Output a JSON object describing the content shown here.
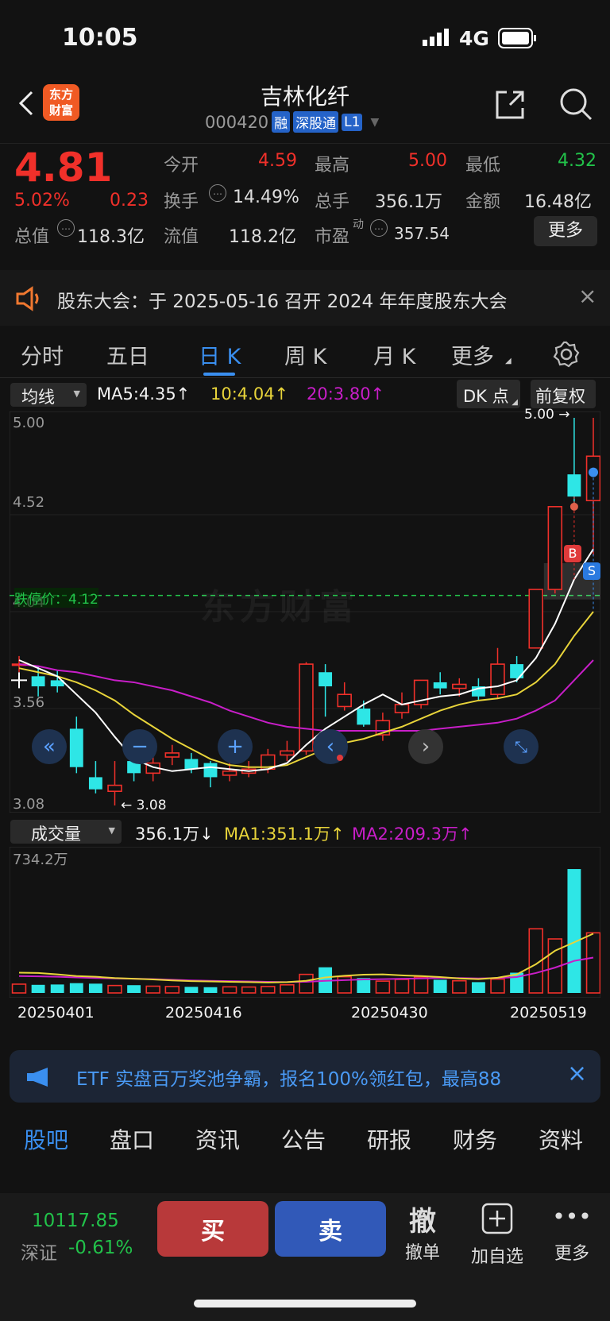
{
  "status_bar": {
    "time": "10:05",
    "network": "4G"
  },
  "header": {
    "title": "吉林化纤",
    "code": "000420",
    "badges": [
      "融",
      "深股通",
      "L1"
    ],
    "logo_text": [
      "东方",
      "财富"
    ]
  },
  "quote": {
    "price": "4.81",
    "change_pct": "5.02%",
    "change": "0.23",
    "open_label": "今开",
    "open": "4.59",
    "high_label": "最高",
    "high": "5.00",
    "low_label": "最低",
    "low": "4.32",
    "turnover_label": "换手",
    "turnover": "14.49%",
    "volume_label": "总手",
    "volume": "356.1万",
    "amount_label": "金额",
    "amount": "16.48亿",
    "mktcap_label": "总值",
    "mktcap": "118.3亿",
    "float_label": "流值",
    "float": "118.2亿",
    "pe_label": "市盈",
    "pe_sup": "动",
    "pe": "357.54",
    "more_label": "更多"
  },
  "notice": {
    "text": "股东大会：于 2025-05-16 召开 2024 年年度股东大会"
  },
  "chart_tabs": [
    "分时",
    "五日",
    "日 K",
    "周 K",
    "月 K",
    "更多"
  ],
  "active_tab": "日 K",
  "kline_legend": {
    "indicator": "均线",
    "ma5": "MA5:4.35↑",
    "ma10": "10:4.04↑",
    "ma20": "20:3.80↑",
    "dk": "DK 点",
    "adjust": "前复权"
  },
  "kline_axis": {
    "top": "5.00",
    "mid1": "4.52",
    "mid2": "4.04",
    "mid3": "3.56",
    "bottom": "3.08"
  },
  "kline_annotations": {
    "high_label": "5.00",
    "low_label": "3.08",
    "limit_down_label": "跌停价：",
    "limit_down_value": "4.12",
    "watermark": "东方财富",
    "buy_mark": "B",
    "sell_mark": "S"
  },
  "colors": {
    "up": "#f0302a",
    "down": "#2ee6e6",
    "ma5": "#ffffff",
    "ma10": "#e8d43a",
    "ma20": "#c81ec8",
    "accent": "#3a8ff0"
  },
  "volume_legend": {
    "indicator": "成交量",
    "value": "356.1万↓",
    "ma1": "MA1:351.1万↑",
    "ma2": "MA2:209.3万↑"
  },
  "volume_axis": {
    "top": "734.2万"
  },
  "dates": [
    "20250401",
    "20250416",
    "20250430",
    "20250519"
  ],
  "chart_data": {
    "type": "candlestick",
    "ylim": [
      3.08,
      5.0
    ],
    "candles": [
      {
        "o": 3.78,
        "c": 3.78,
        "h": 3.82,
        "l": 3.74
      },
      {
        "o": 3.72,
        "c": 3.67,
        "h": 3.77,
        "l": 3.62
      },
      {
        "o": 3.7,
        "c": 3.67,
        "h": 3.75,
        "l": 3.64
      },
      {
        "o": 3.46,
        "c": 3.27,
        "h": 3.52,
        "l": 3.24
      },
      {
        "o": 3.22,
        "c": 3.16,
        "h": 3.3,
        "l": 3.14
      },
      {
        "o": 3.15,
        "c": 3.18,
        "h": 3.3,
        "l": 3.08
      },
      {
        "o": 3.3,
        "c": 3.24,
        "h": 3.35,
        "l": 3.2
      },
      {
        "o": 3.24,
        "c": 3.29,
        "h": 3.33,
        "l": 3.2
      },
      {
        "o": 3.32,
        "c": 3.34,
        "h": 3.38,
        "l": 3.28
      },
      {
        "o": 3.31,
        "c": 3.26,
        "h": 3.34,
        "l": 3.24
      },
      {
        "o": 3.29,
        "c": 3.22,
        "h": 3.3,
        "l": 3.17
      },
      {
        "o": 3.23,
        "c": 3.25,
        "h": 3.3,
        "l": 3.2
      },
      {
        "o": 3.24,
        "c": 3.26,
        "h": 3.3,
        "l": 3.22
      },
      {
        "o": 3.26,
        "c": 3.33,
        "h": 3.36,
        "l": 3.24
      },
      {
        "o": 3.33,
        "c": 3.35,
        "h": 3.4,
        "l": 3.3
      },
      {
        "o": 3.35,
        "c": 3.78,
        "h": 3.79,
        "l": 3.33
      },
      {
        "o": 3.74,
        "c": 3.67,
        "h": 3.78,
        "l": 3.52
      },
      {
        "o": 3.57,
        "c": 3.63,
        "h": 3.69,
        "l": 3.55
      },
      {
        "o": 3.56,
        "c": 3.48,
        "h": 3.6,
        "l": 3.47
      },
      {
        "o": 3.43,
        "c": 3.5,
        "h": 3.54,
        "l": 3.4
      },
      {
        "o": 3.54,
        "c": 3.58,
        "h": 3.64,
        "l": 3.51
      },
      {
        "o": 3.58,
        "c": 3.7,
        "h": 3.7,
        "l": 3.56
      },
      {
        "o": 3.69,
        "c": 3.66,
        "h": 3.74,
        "l": 3.63
      },
      {
        "o": 3.66,
        "c": 3.68,
        "h": 3.71,
        "l": 3.62
      },
      {
        "o": 3.67,
        "c": 3.62,
        "h": 3.71,
        "l": 3.6
      },
      {
        "o": 3.63,
        "c": 3.78,
        "h": 3.86,
        "l": 3.61
      },
      {
        "o": 3.78,
        "c": 3.71,
        "h": 3.82,
        "l": 3.69
      },
      {
        "o": 3.86,
        "c": 4.15,
        "h": 4.15,
        "l": 3.86
      },
      {
        "o": 4.15,
        "c": 4.56,
        "h": 4.56,
        "l": 4.13
      },
      {
        "o": 4.72,
        "c": 4.61,
        "h": 5.0,
        "l": 4.56
      },
      {
        "o": 4.59,
        "c": 4.81,
        "h": 5.0,
        "l": 4.32
      }
    ],
    "ma5": [
      3.8,
      3.76,
      3.72,
      3.63,
      3.54,
      3.42,
      3.31,
      3.27,
      3.25,
      3.26,
      3.27,
      3.26,
      3.25,
      3.26,
      3.29,
      3.38,
      3.46,
      3.52,
      3.58,
      3.63,
      3.58,
      3.6,
      3.62,
      3.63,
      3.66,
      3.67,
      3.7,
      3.81,
      3.98,
      4.2,
      4.35
    ],
    "ma10": [
      3.76,
      3.74,
      3.72,
      3.69,
      3.65,
      3.6,
      3.53,
      3.47,
      3.41,
      3.36,
      3.31,
      3.28,
      3.27,
      3.27,
      3.28,
      3.32,
      3.36,
      3.39,
      3.41,
      3.44,
      3.47,
      3.51,
      3.55,
      3.58,
      3.6,
      3.61,
      3.63,
      3.69,
      3.78,
      3.92,
      4.04
    ],
    "ma20": [
      3.78,
      3.77,
      3.75,
      3.74,
      3.72,
      3.7,
      3.69,
      3.67,
      3.65,
      3.62,
      3.59,
      3.55,
      3.52,
      3.49,
      3.47,
      3.46,
      3.45,
      3.45,
      3.45,
      3.45,
      3.45,
      3.45,
      3.46,
      3.47,
      3.48,
      3.49,
      3.51,
      3.55,
      3.6,
      3.7,
      3.8
    ],
    "volume": [
      52,
      48,
      50,
      58,
      55,
      44,
      46,
      40,
      38,
      36,
      34,
      36,
      35,
      38,
      48,
      110,
      152,
      96,
      88,
      70,
      80,
      94,
      78,
      72,
      64,
      82,
      120,
      380,
      320,
      734,
      356.1
    ],
    "vol_ma1": [
      120,
      118,
      110,
      100,
      96,
      88,
      84,
      80,
      74,
      70,
      68,
      66,
      64,
      62,
      64,
      72,
      92,
      102,
      108,
      110,
      104,
      100,
      94,
      86,
      82,
      90,
      110,
      170,
      250,
      300,
      351.1
    ],
    "vol_ma2": [
      100,
      98,
      96,
      92,
      88,
      86,
      84,
      82,
      78,
      74,
      72,
      70,
      68,
      66,
      64,
      66,
      72,
      76,
      80,
      82,
      84,
      86,
      88,
      88,
      86,
      88,
      94,
      118,
      150,
      190,
      209.3
    ],
    "vol_ylim": [
      0,
      734.2
    ],
    "limit_down": 4.12
  },
  "ctrl_icons": [
    "double-left-icon",
    "zoom-out-icon",
    "zoom-in-icon",
    "scroll-left-icon",
    "scroll-right-icon",
    "fullscreen-icon"
  ],
  "ad": {
    "text": "ETF 实盘百万奖池争霸，报名100%领红包，最高88"
  },
  "bottom_tabs": [
    "股吧",
    "盘口",
    "资讯",
    "公告",
    "研报",
    "财务",
    "资料"
  ],
  "bottom_bar": {
    "index_value": "10117.85",
    "index_name": "深证",
    "index_change": "-0.61%",
    "buy": "买",
    "sell": "卖",
    "cancel_icon": "撤",
    "cancel": "撤单",
    "add": "加自选",
    "more": "更多"
  }
}
